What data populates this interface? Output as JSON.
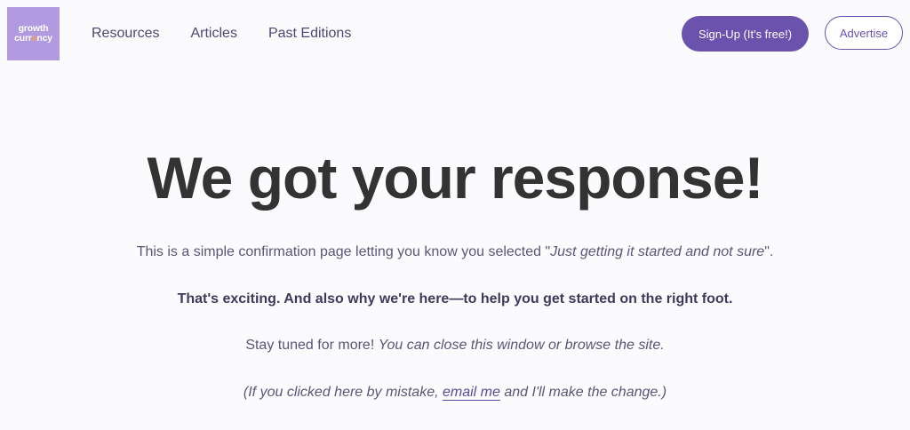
{
  "logo": {
    "line1": "growth",
    "line2_a": "curr",
    "line2_dot": "e",
    "line2_b": "ncy",
    "brand_color": "#b19ae0",
    "accent_color": "#f3a64b"
  },
  "nav": {
    "items": [
      {
        "label": "Resources"
      },
      {
        "label": "Articles"
      },
      {
        "label": "Past Editions"
      }
    ]
  },
  "header": {
    "signup_label": "Sign-Up (It's free!)",
    "advertise_label": "Advertise",
    "accent_color": "#6a52ad"
  },
  "main": {
    "headline": "We got your response!",
    "line1_prefix": "This is a simple confirmation page letting you know you selected \"",
    "line1_selection": "Just getting it started and not sure",
    "line1_suffix": "\".",
    "line2": "That's exciting. And also why we're here—to help you get started on the right foot.",
    "line3_prefix": "Stay tuned for more! ",
    "line3_italic": "You can close this window or browse the site.",
    "line4_prefix": "(If you clicked here by mistake, ",
    "line4_link": "email me",
    "line4_suffix": " and I'll make the change.)"
  }
}
